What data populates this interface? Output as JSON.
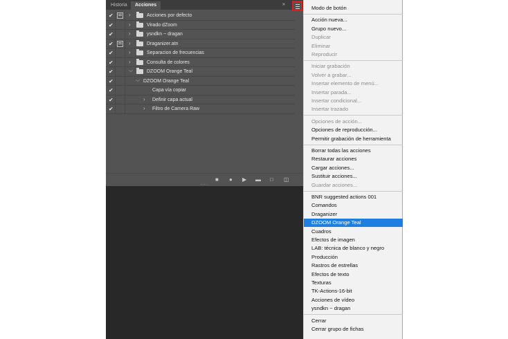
{
  "panel": {
    "tabs": [
      "Historia",
      "Acciones"
    ],
    "collapse_glyph": "»",
    "menu_icon": "hamburger-menu-icon",
    "rows": [
      {
        "label": "Acciones por defecto",
        "checked": true,
        "dialog": true,
        "expanded": false,
        "type": "set"
      },
      {
        "label": "Virado dZoom",
        "checked": true,
        "dialog": false,
        "expanded": false,
        "type": "set"
      },
      {
        "label": "ysndkn ~ dragan",
        "checked": true,
        "dialog": false,
        "expanded": false,
        "type": "set"
      },
      {
        "label": "Draganizer.atn",
        "checked": true,
        "dialog": true,
        "expanded": false,
        "type": "set"
      },
      {
        "label": "Separacion de frecuencias",
        "checked": true,
        "dialog": false,
        "expanded": false,
        "type": "set"
      },
      {
        "label": "Consulta de colores",
        "checked": true,
        "dialog": false,
        "expanded": false,
        "type": "set"
      },
      {
        "label": "DZOOM Orange Teal",
        "checked": true,
        "dialog": false,
        "expanded": true,
        "type": "set"
      },
      {
        "label": "DZOOM Orange Teal",
        "checked": true,
        "dialog": false,
        "expanded": true,
        "type": "action"
      },
      {
        "label": "Capa vía copiar",
        "checked": true,
        "dialog": false,
        "expanded": false,
        "type": "step"
      },
      {
        "label": "Definir capa actual",
        "checked": true,
        "dialog": false,
        "expanded": false,
        "type": "step-expandable"
      },
      {
        "label": "Filtro de Camera Raw",
        "checked": true,
        "dialog": false,
        "expanded": false,
        "type": "step-expandable"
      }
    ],
    "bottom_icons": [
      "stop-icon",
      "record-icon",
      "play-icon",
      "new-set-folder-icon",
      "new-action-icon",
      "trash-icon"
    ]
  },
  "menu": {
    "groups": [
      [
        {
          "label": "Modo de botón",
          "disabled": false
        }
      ],
      [
        {
          "label": "Acción nueva...",
          "disabled": false
        },
        {
          "label": "Grupo nuevo...",
          "disabled": false
        },
        {
          "label": "Duplicar",
          "disabled": true
        },
        {
          "label": "Eliminar",
          "disabled": true
        },
        {
          "label": "Reproducir",
          "disabled": true
        }
      ],
      [
        {
          "label": "Iniciar grabación",
          "disabled": true
        },
        {
          "label": "Volver a grabar...",
          "disabled": true
        },
        {
          "label": "Insertar elemento de menú...",
          "disabled": true
        },
        {
          "label": "Insertar parada...",
          "disabled": true
        },
        {
          "label": "Insertar condicional...",
          "disabled": true
        },
        {
          "label": "Insertar trazado",
          "disabled": true
        }
      ],
      [
        {
          "label": "Opciones de acción...",
          "disabled": true
        },
        {
          "label": "Opciones de reproducción...",
          "disabled": false
        },
        {
          "label": "Permitir grabación de herramienta",
          "disabled": false
        }
      ],
      [
        {
          "label": "Borrar todas las acciones",
          "disabled": false
        },
        {
          "label": "Restaurar acciones",
          "disabled": false
        },
        {
          "label": "Cargar acciones...",
          "disabled": false
        },
        {
          "label": "Sustituir acciones...",
          "disabled": false
        },
        {
          "label": "Guardar acciones...",
          "disabled": true
        }
      ],
      [
        {
          "label": "BNR suggested actions 001",
          "disabled": false
        },
        {
          "label": "Comandos",
          "disabled": false
        },
        {
          "label": "Draganizer",
          "disabled": false
        },
        {
          "label": "DZOOM Orange Teal",
          "disabled": false,
          "selected": true
        },
        {
          "label": "Cuadros",
          "disabled": false
        },
        {
          "label": "Efectos de imagen",
          "disabled": false
        },
        {
          "label": "LAB: técnica de blanco y negro",
          "disabled": false
        },
        {
          "label": "Producción",
          "disabled": false
        },
        {
          "label": "Rastros de estrellas",
          "disabled": false
        },
        {
          "label": "Efectos de texto",
          "disabled": false
        },
        {
          "label": "Texturas",
          "disabled": false
        },
        {
          "label": "TK-Actions-16-bit",
          "disabled": false
        },
        {
          "label": "Acciones de vídeo",
          "disabled": false
        },
        {
          "label": "ysndkn ~ dragan",
          "disabled": false
        }
      ],
      [
        {
          "label": "Cerrar",
          "disabled": false
        },
        {
          "label": "Cerrar grupo de fichas",
          "disabled": false
        }
      ]
    ]
  },
  "colors": {
    "panel_bg": "#535353",
    "dark_bg": "#282828",
    "menu_bg": "#f2f2f2",
    "highlight": "#1f7fe0",
    "red_outline": "#e21b1b"
  }
}
